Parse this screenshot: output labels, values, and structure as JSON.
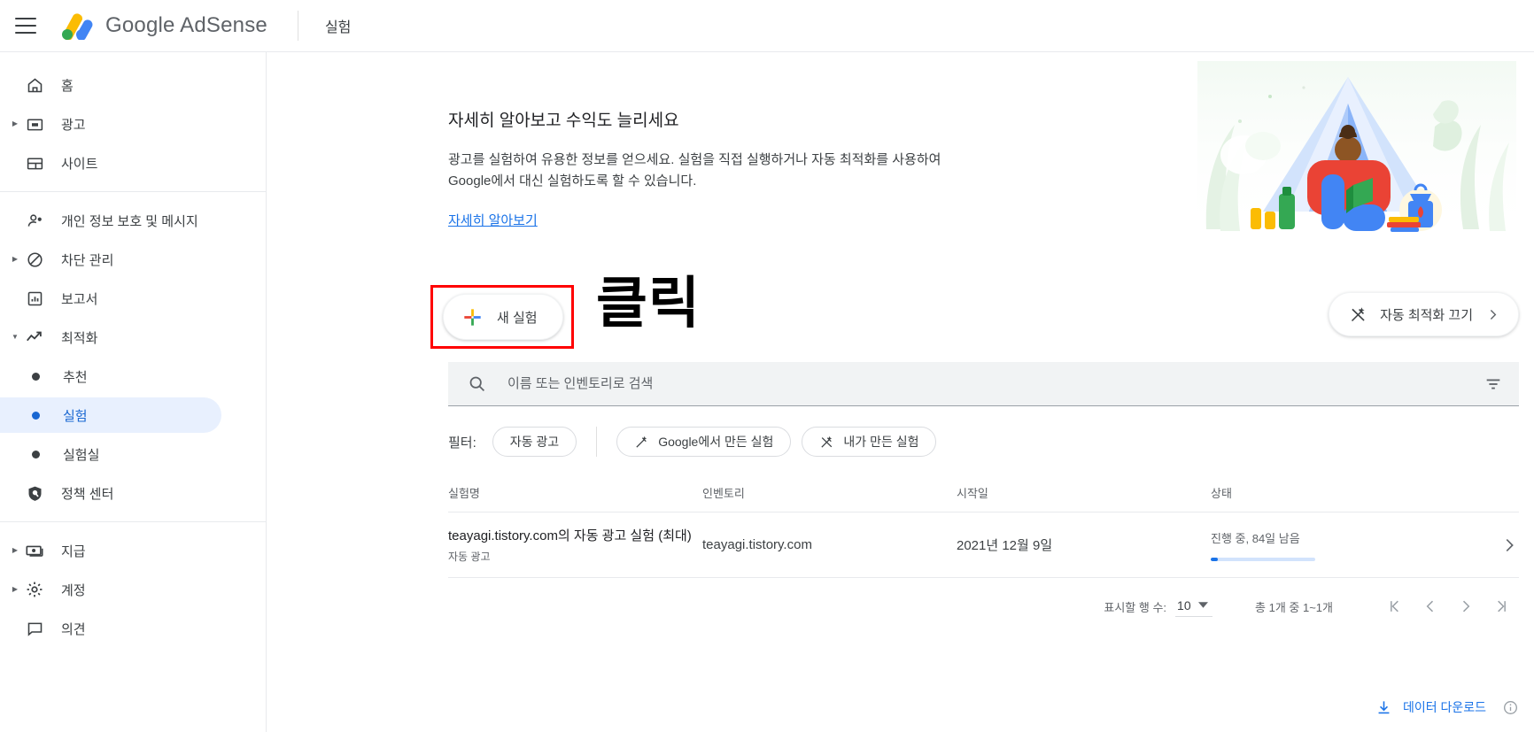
{
  "header": {
    "menu_icon": "hamburger-menu-icon",
    "brand": "Google AdSense",
    "page_title": "실험"
  },
  "sidebar": {
    "groups": [
      {
        "items": [
          {
            "label": "홈",
            "icon": "home-icon",
            "expandable": false,
            "selected": false
          },
          {
            "label": "광고",
            "icon": "ads-icon",
            "expandable": true,
            "selected": false
          },
          {
            "label": "사이트",
            "icon": "sites-icon",
            "expandable": false,
            "selected": false
          }
        ]
      },
      {
        "items": [
          {
            "label": "개인 정보 보호 및 메시지",
            "icon": "privacy-person-icon",
            "expandable": false,
            "selected": false
          },
          {
            "label": "차단 관리",
            "icon": "block-icon",
            "expandable": true,
            "selected": false
          },
          {
            "label": "보고서",
            "icon": "reports-bar-chart-icon",
            "expandable": false,
            "selected": false
          },
          {
            "label": "최적화",
            "icon": "optimization-trending-up-icon",
            "expandable": true,
            "expanded": true,
            "selected": false
          }
        ],
        "subitems": [
          {
            "label": "추천",
            "selected": false
          },
          {
            "label": "실험",
            "selected": true
          },
          {
            "label": "실험실",
            "selected": false
          }
        ],
        "after_sub": [
          {
            "label": "정책 센터",
            "icon": "policy-shield-icon",
            "expandable": false,
            "selected": false
          }
        ]
      },
      {
        "items": [
          {
            "label": "지급",
            "icon": "payments-money-icon",
            "expandable": true,
            "selected": false
          },
          {
            "label": "계정",
            "icon": "account-gear-icon",
            "expandable": true,
            "selected": false
          },
          {
            "label": "의견",
            "icon": "feedback-chat-icon",
            "expandable": false,
            "selected": false
          }
        ]
      }
    ]
  },
  "promo": {
    "title": "자세히 알아보고 수익도 늘리세요",
    "body": "광고를 실험하여 유용한 정보를 얻으세요. 실험을 직접 실행하거나 자동 최적화를 사용하여 Google에서 대신 실험하도록 할 수 있습니다.",
    "link": "자세히 알아보기",
    "illustration": "camping-tent-reading-illustration"
  },
  "actions": {
    "new_experiment": {
      "label": "새 실험",
      "icon": "google-plus-icon"
    },
    "annotation": "클릭",
    "annotation_color": "#ff0000",
    "auto_optimization": {
      "label": "자동 최적화 끄기",
      "icon": "magic-wand-off-icon",
      "chevron": "chevron-right-icon"
    }
  },
  "search": {
    "placeholder": "이름 또는 인벤토리로 검색",
    "value": "",
    "icon": "search-icon",
    "filter_icon": "filter-list-icon"
  },
  "filters": {
    "label": "필터:",
    "chips": [
      {
        "label": "자동 광고",
        "icon": null
      },
      {
        "label": "Google에서 만든 실험",
        "icon": "magic-wand-icon"
      },
      {
        "label": "내가 만든 실험",
        "icon": "magic-wand-off-icon"
      }
    ]
  },
  "table": {
    "columns": [
      "실험명",
      "인벤토리",
      "시작일",
      "상태"
    ],
    "rows": [
      {
        "name": "teayagi.tistory.com의 자동 광고 실험 (최대)",
        "name_sub": "자동 광고",
        "inventory": "teayagi.tistory.com",
        "start_date": "2021년 12월 9일",
        "status": "진행 중, 84일 남음",
        "progress_percent": 7,
        "chevron": "chevron-right-icon"
      }
    ]
  },
  "pagination": {
    "rows_label": "표시할 행 수:",
    "rows_value": "10",
    "range_label": "총 1개 중 1~1개",
    "first_icon": "first-page-icon",
    "prev_icon": "previous-page-icon",
    "next_icon": "next-page-icon",
    "last_icon": "last-page-icon"
  },
  "footer": {
    "download_label": "데이터 다운로드",
    "download_icon": "download-icon",
    "info_icon": "info-circle-icon"
  },
  "colors": {
    "accent_blue": "#1a73e8",
    "selected_bg": "#e8f0fe",
    "selected_text": "#1967d2",
    "annotation_red": "#ff0000",
    "text_primary": "#202124",
    "text_secondary": "#5f6368"
  }
}
